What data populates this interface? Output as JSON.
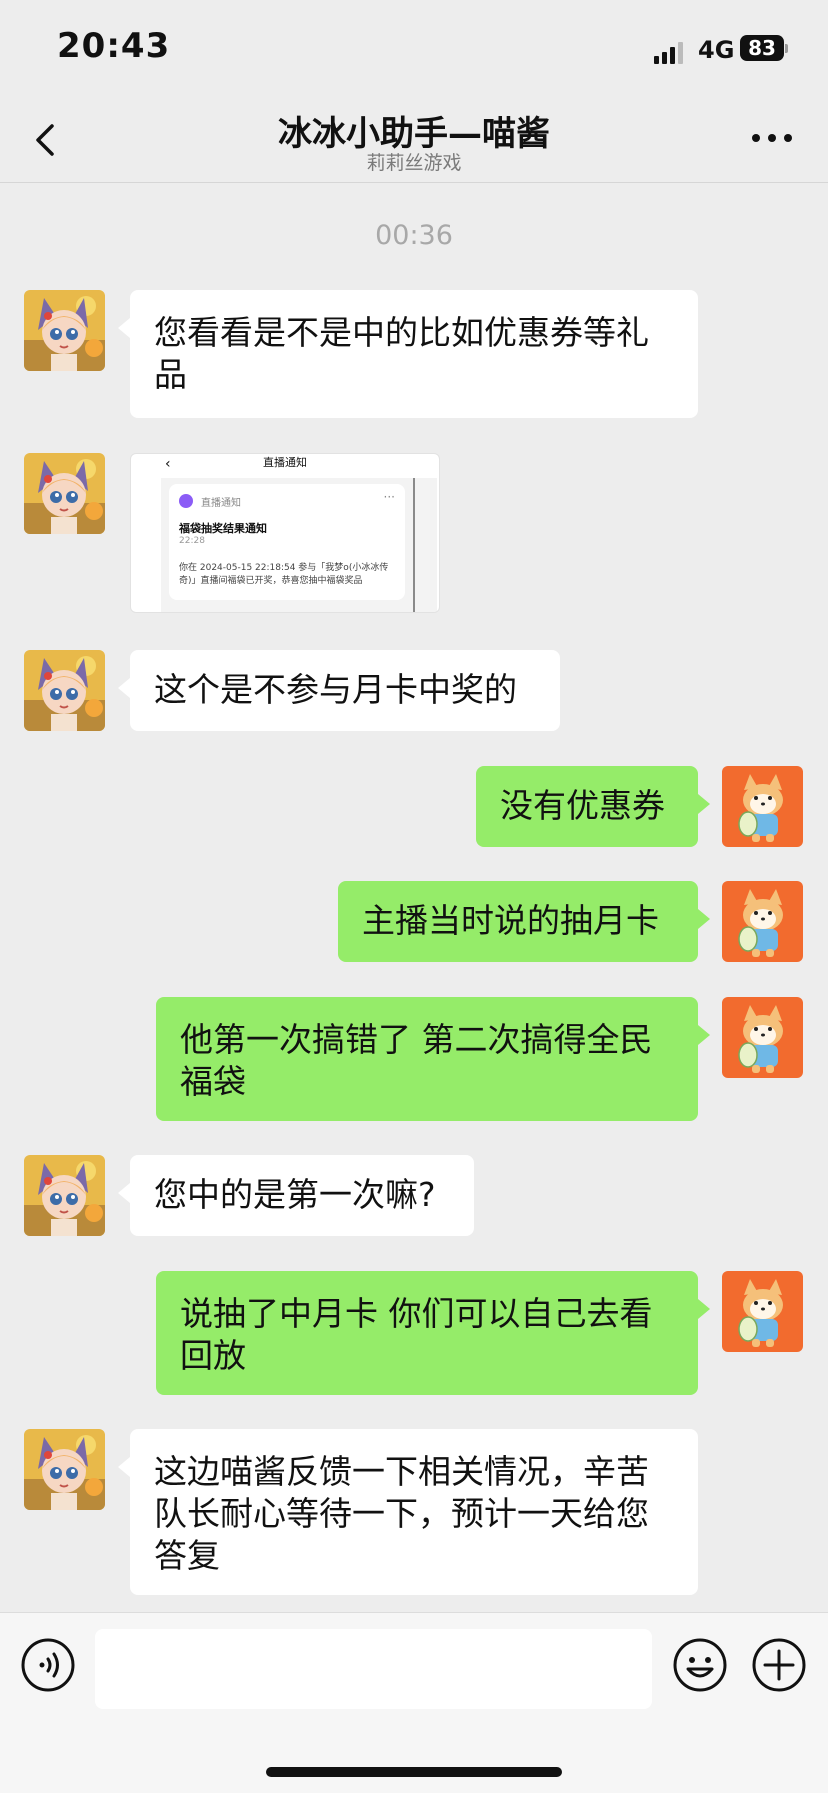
{
  "status_bar": {
    "time": "20:43",
    "network": "4G",
    "battery": "83"
  },
  "header": {
    "title": "冰冰小助手—喵酱",
    "subtitle": "莉莉丝游戏",
    "back_icon": "chevron-left-icon",
    "more_icon": "more-dots-icon"
  },
  "chat": {
    "time_separator": "00:36",
    "messages": [
      {
        "side": "in",
        "text": "您看看是不是中的比如优惠券等礼品"
      },
      {
        "side": "in",
        "type": "image",
        "image": {
          "header": "直播通知",
          "label": "直播通知",
          "title": "福袋抽奖结果通知",
          "time": "22:28",
          "body": "你在 2024-05-15 22:18:54 参与「我梦o(小冰冰传奇)」直播间福袋已开奖，恭喜您抽中福袋奖品"
        }
      },
      {
        "side": "in",
        "text": "这个是不参与月卡中奖的"
      },
      {
        "side": "out",
        "text": "没有优惠券"
      },
      {
        "side": "out",
        "text": "主播当时说的抽月卡"
      },
      {
        "side": "out",
        "text": "他第一次搞错了 第二次搞得全民福袋"
      },
      {
        "side": "in",
        "text": "您中的是第一次嘛?"
      },
      {
        "side": "out",
        "text": "说抽了中月卡 你们可以自己去看回放"
      },
      {
        "side": "in",
        "text": "这边喵酱反馈一下相关情况，辛苦队长耐心等待一下，预计一天给您答复"
      }
    ]
  },
  "input_bar": {
    "voice_icon": "voice-icon",
    "input_value": "",
    "emoji_icon": "emoji-icon",
    "plus_icon": "plus-icon"
  },
  "colors": {
    "background": "#ededed",
    "incoming_bubble": "#ffffff",
    "outgoing_bubble": "#95ec69",
    "self_avatar_bg": "#f26b2e",
    "agent_avatar_bg": "#e8b94a"
  }
}
